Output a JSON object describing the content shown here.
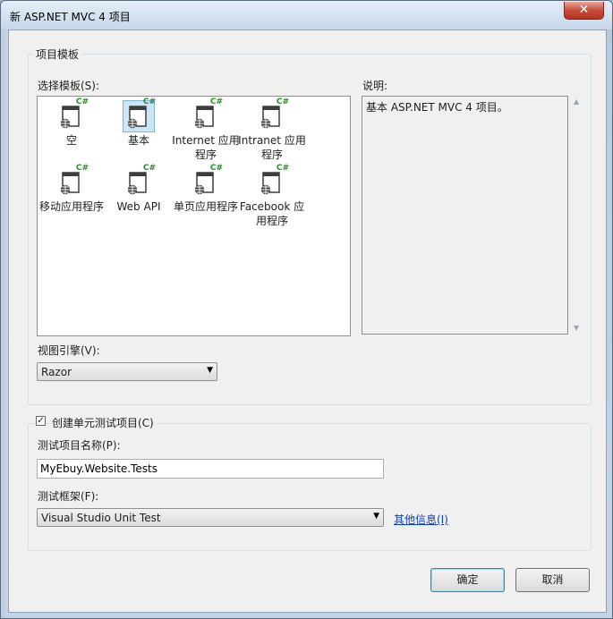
{
  "window": {
    "title": "新 ASP.NET MVC 4 项目",
    "close_glyph": "✕"
  },
  "project_template": {
    "group_title": "项目模板",
    "select_label": "选择模板(S):",
    "templates": [
      {
        "label": "空",
        "icon": "web-project-csharp-icon",
        "selected": false
      },
      {
        "label": "基本",
        "icon": "web-project-csharp-icon",
        "selected": true
      },
      {
        "label": "Internet 应用程序",
        "icon": "web-project-csharp-icon",
        "selected": false
      },
      {
        "label": "Intranet 应用程序",
        "icon": "web-project-csharp-icon",
        "selected": false
      },
      {
        "label": "移动应用程序",
        "icon": "web-project-csharp-icon",
        "selected": false
      },
      {
        "label": "Web API",
        "icon": "web-project-csharp-icon",
        "selected": false
      },
      {
        "label": "单页应用程序",
        "icon": "web-project-csharp-icon",
        "selected": false
      },
      {
        "label": "Facebook 应用程序",
        "icon": "web-project-csharp-icon",
        "selected": false
      }
    ],
    "icon_badge": "C#",
    "description_label": "说明:",
    "description_text": "基本 ASP.NET MVC 4 项目。",
    "view_engine_label": "视图引擎(V):",
    "view_engine_value": "Razor"
  },
  "unit_test": {
    "create_label": "创建单元测试项目(C)",
    "create_checked": true,
    "project_name_label": "测试项目名称(P):",
    "project_name_value": "MyEbuy.Website.Tests",
    "framework_label": "测试框架(F):",
    "framework_value": "Visual Studio Unit Test",
    "more_info_link": "其他信息(I)"
  },
  "buttons": {
    "ok": "确定",
    "cancel": "取消"
  },
  "colors": {
    "accent_link": "#0c3dc6",
    "close_button": "#c74c3c",
    "badge_green": "#2b8a2b"
  }
}
